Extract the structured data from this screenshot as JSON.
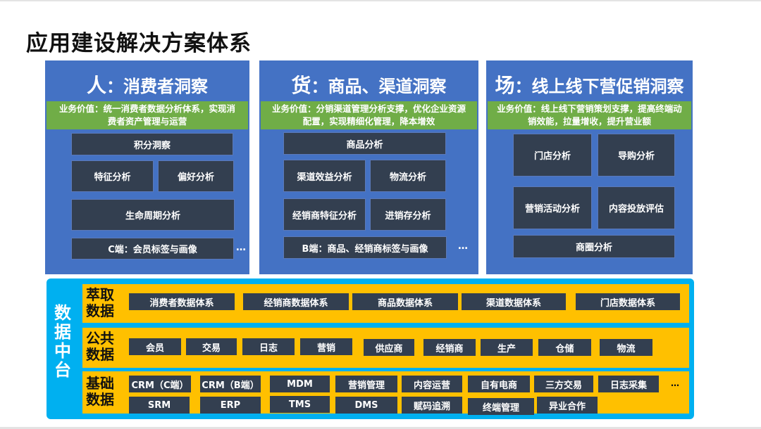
{
  "page_title": "应用建设解决方案体系",
  "panels": [
    {
      "title_char": "人",
      "title_rest": "：消费者洞察",
      "value_line1": "业务价值：统一消费者数据分析体系，实现消",
      "value_line2": "费者资产管理与运营",
      "tiles": [
        "积分洞察",
        "特征分析",
        "偏好分析",
        "生命周期分析",
        "C端：会员标签与画像"
      ],
      "more": "…"
    },
    {
      "title_char": "货",
      "title_rest": "：商品、渠道洞察",
      "value_line1": "业务价值：分销渠道管理分析支撑，优化企业资源",
      "value_line2": "配置，实现精细化管理，降本增效",
      "tiles": [
        "商品分析",
        "渠道效益分析",
        "物流分析",
        "经销商特征分析",
        "进销存分析",
        "B端：商品、经销商标签与画像"
      ],
      "more": "…"
    },
    {
      "title_char": "场",
      "title_rest": "：线上线下营促销洞察",
      "value_line1": "业务价值：线上线下营销策划支撑，提高终端动",
      "value_line2": "销效能，拉量增收，提升营业额",
      "tiles": [
        "门店分析",
        "导购分析",
        "营销活动分析",
        "内容投放评估",
        "商圈分析"
      ]
    }
  ],
  "data_platform": {
    "label": "数据中台",
    "bands": [
      {
        "label": "萃取数据",
        "items": [
          "消费者数据体系",
          "经销商数据体系",
          "商品数据体系",
          "渠道数据体系",
          "门店数据体系"
        ]
      },
      {
        "label": "公共数据",
        "items": [
          "会员",
          "交易",
          "日志",
          "营销",
          "供应商",
          "经销商",
          "生产",
          "仓储",
          "物流"
        ]
      },
      {
        "label": "基础数据",
        "row1": [
          "CRM（C端）",
          "CRM（B端）",
          "MDM",
          "营销管理",
          "内容运营",
          "自有电商",
          "三方交易",
          "日志采集"
        ],
        "row2": [
          "SRM",
          "ERP",
          "TMS",
          "DMS",
          "赋码追溯",
          "终端管理",
          "异业合作"
        ],
        "more": "…"
      }
    ]
  },
  "colors": {
    "panel_blue": "#4472c4",
    "value_green": "#70ad47",
    "tile_dark": "#333f50",
    "platform_cyan": "#00b0f0",
    "band_yellow": "#ffc000"
  }
}
